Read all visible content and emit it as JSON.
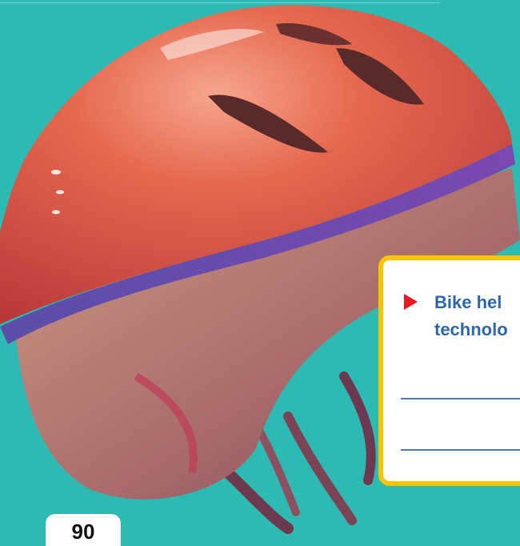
{
  "colors": {
    "background": "#2fb9b3",
    "helmet_shell": "#e0604a",
    "card_border": "#f7c500",
    "question_text": "#2e66ab",
    "arrow": "#e8191f"
  },
  "photo": {
    "subject_icon": "bike-helmet-photo"
  },
  "question_card": {
    "bullet_icon": "red-triangle-arrow-icon",
    "lines": [
      "Bike hel",
      "technolo"
    ]
  },
  "page": {
    "number": "90"
  }
}
